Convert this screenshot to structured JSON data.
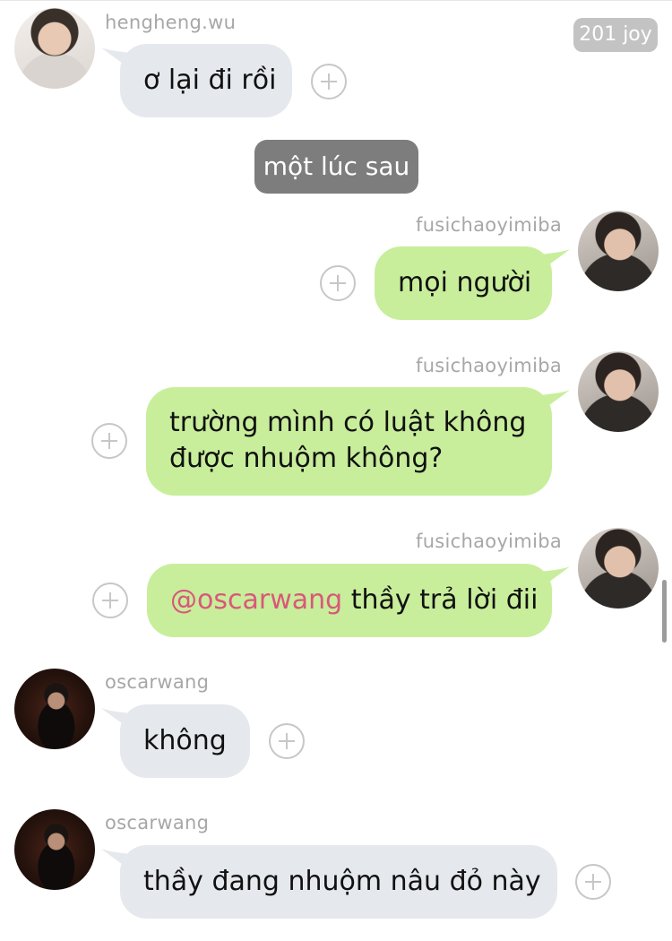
{
  "badge": "201 joy",
  "system_message": "một lúc sau",
  "messages": [
    {
      "sender": "hengheng.wu",
      "text": "ơ lại đi rồi"
    },
    {
      "sender": "fusichaoyimiba",
      "text": "mọi người"
    },
    {
      "sender": "fusichaoyimiba",
      "line1": "trường mình có luật không",
      "line2": "được nhuộm không?"
    },
    {
      "sender": "fusichaoyimiba",
      "mention": "@oscarwang",
      "text": " thầy trả lời đii"
    },
    {
      "sender": "oscarwang",
      "text": "không"
    },
    {
      "sender": "oscarwang",
      "text": "thầy đang nhuộm nâu đỏ này"
    }
  ],
  "icons": {
    "add_reaction": "plus-circle-icon"
  },
  "colors": {
    "incoming_bubble": "#e5e8ed",
    "outgoing_bubble": "#c8ee9b",
    "mention": "#d9587a",
    "system_bubble": "#7d7d7d"
  }
}
